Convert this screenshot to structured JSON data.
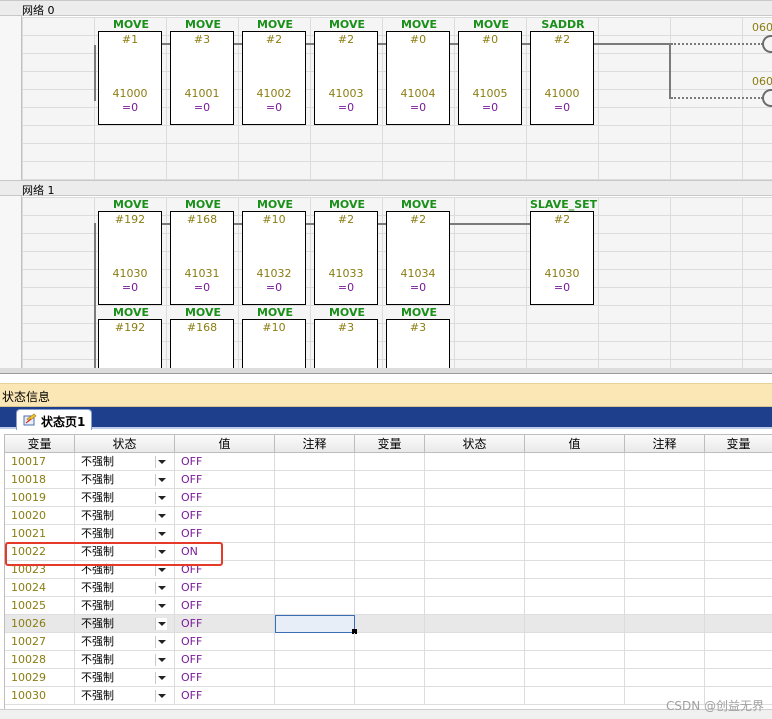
{
  "ladder": {
    "networks": [
      {
        "label": "网络 0",
        "blocks": [
          {
            "name": "MOVE",
            "p1": "#1",
            "p2": "41000",
            "p3": "=0"
          },
          {
            "name": "MOVE",
            "p1": "#3",
            "p2": "41001",
            "p3": "=0"
          },
          {
            "name": "MOVE",
            "p1": "#2",
            "p2": "41002",
            "p3": "=0"
          },
          {
            "name": "MOVE",
            "p1": "#2",
            "p2": "41003",
            "p3": "=0"
          },
          {
            "name": "MOVE",
            "p1": "#0",
            "p2": "41004",
            "p3": "=0"
          },
          {
            "name": "MOVE",
            "p1": "#0",
            "p2": "41005",
            "p3": "=0"
          },
          {
            "name": "SADDR",
            "p1": "#2",
            "p2": "41000",
            "p3": "=0"
          }
        ],
        "coils": [
          "060",
          "060"
        ]
      },
      {
        "label": "网络 1",
        "blocks_row1": [
          {
            "name": "MOVE",
            "p1": "#192",
            "p2": "41030",
            "p3": "=0"
          },
          {
            "name": "MOVE",
            "p1": "#168",
            "p2": "41031",
            "p3": "=0"
          },
          {
            "name": "MOVE",
            "p1": "#10",
            "p2": "41032",
            "p3": "=0"
          },
          {
            "name": "MOVE",
            "p1": "#2",
            "p2": "41033",
            "p3": "=0"
          },
          {
            "name": "MOVE",
            "p1": "#2",
            "p2": "41034",
            "p3": "=0"
          },
          {
            "name": "SLAVE_SET",
            "p1": "#2",
            "p2": "41030",
            "p3": "=0"
          }
        ],
        "blocks_row2": [
          {
            "name": "MOVE",
            "p1": "#192"
          },
          {
            "name": "MOVE",
            "p1": "#168"
          },
          {
            "name": "MOVE",
            "p1": "#10"
          },
          {
            "name": "MOVE",
            "p1": "#3"
          },
          {
            "name": "MOVE",
            "p1": "#3"
          }
        ]
      }
    ]
  },
  "status_panel": {
    "title": "状态信息",
    "tab_label": "状态页1",
    "headers": [
      "变量",
      "状态",
      "值",
      "注释",
      "变量",
      "状态",
      "值",
      "注释",
      "变量"
    ],
    "rows": [
      {
        "addr": "10017",
        "state": "不强制",
        "value": "OFF"
      },
      {
        "addr": "10018",
        "state": "不强制",
        "value": "OFF"
      },
      {
        "addr": "10019",
        "state": "不强制",
        "value": "OFF"
      },
      {
        "addr": "10020",
        "state": "不强制",
        "value": "OFF"
      },
      {
        "addr": "10021",
        "state": "不强制",
        "value": "OFF"
      },
      {
        "addr": "10022",
        "state": "不强制",
        "value": "ON"
      },
      {
        "addr": "10023",
        "state": "不强制",
        "value": "OFF"
      },
      {
        "addr": "10024",
        "state": "不强制",
        "value": "OFF"
      },
      {
        "addr": "10025",
        "state": "不强制",
        "value": "OFF"
      },
      {
        "addr": "10026",
        "state": "不强制",
        "value": "OFF"
      },
      {
        "addr": "10027",
        "state": "不强制",
        "value": "OFF"
      },
      {
        "addr": "10028",
        "state": "不强制",
        "value": "OFF"
      },
      {
        "addr": "10029",
        "state": "不强制",
        "value": "OFF"
      },
      {
        "addr": "10030",
        "state": "不强制",
        "value": "OFF"
      }
    ]
  },
  "watermark": "CSDN @创益无界",
  "colors": {
    "block_title": "#1a8f1a",
    "operand": "#8a7d12",
    "value": "#7a1a9a",
    "highlight": "#e53a2a",
    "tab_strip": "#1e3f8c",
    "panel_title_bg": "#fbe7b6"
  }
}
